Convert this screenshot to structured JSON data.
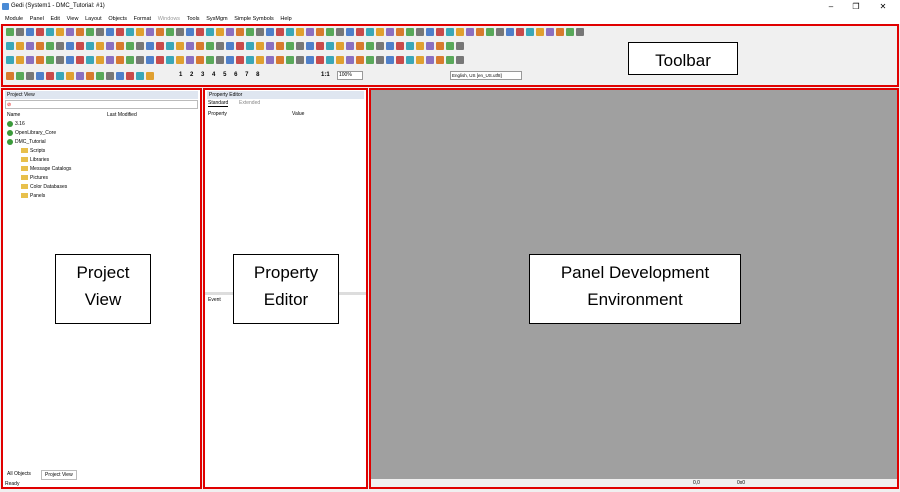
{
  "window": {
    "title": "Gedi (System1 - DMC_Tutorial: #1)",
    "minimize": "–",
    "maximize": "❐",
    "close": "✕"
  },
  "menu": [
    "Module",
    "Panel",
    "Edit",
    "View",
    "Layout",
    "Objects",
    "Format",
    "Windows",
    "Tools",
    "SysMgm",
    "Simple Symbols",
    "Help"
  ],
  "toolbar": {
    "zoom": "100%",
    "ratio": "1:1",
    "language": "English, US [en_US.utf8]",
    "numbers": [
      "1",
      "2",
      "3",
      "4",
      "5",
      "6",
      "7",
      "8"
    ]
  },
  "annotations": {
    "toolbar": "Toolbar",
    "project_view_line1": "Project",
    "project_view_line2": "View",
    "property_editor_line1": "Property",
    "property_editor_line2": "Editor",
    "pde_line1": "Panel Development",
    "pde_line2": "Environment"
  },
  "project_view": {
    "header": "Project View",
    "col_name": "Name",
    "col_modified": "Last Modified",
    "tree": [
      {
        "label": "3.16",
        "indent": 0,
        "icon": "project-icon"
      },
      {
        "label": "OpenLibrary_Core",
        "indent": 0,
        "icon": "project-icon"
      },
      {
        "label": "DMC_Tutorial",
        "indent": 0,
        "icon": "project-icon"
      },
      {
        "label": "Scripts",
        "indent": 1,
        "icon": "folder-icon"
      },
      {
        "label": "Libraries",
        "indent": 1,
        "icon": "folder-icon"
      },
      {
        "label": "Message Catalogs",
        "indent": 1,
        "icon": "folder-icon"
      },
      {
        "label": "Pictures",
        "indent": 1,
        "icon": "folder-icon"
      },
      {
        "label": "Color Databases",
        "indent": 1,
        "icon": "folder-icon"
      },
      {
        "label": "Panels",
        "indent": 1,
        "icon": "folder-icon"
      }
    ],
    "tabs": [
      "All Objects",
      "Project View"
    ]
  },
  "property_editor": {
    "header": "Property Editor",
    "tabs": [
      "Standard",
      "Extended"
    ],
    "col_property": "Property",
    "col_value": "Value",
    "event_label": "Event"
  },
  "status": {
    "left": "Ready",
    "coords": "0,0",
    "size": "0x0"
  },
  "colors": {
    "frame": "#e00000",
    "canvas": "#a0a0a0"
  }
}
